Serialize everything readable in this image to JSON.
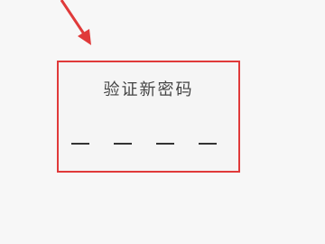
{
  "dialog": {
    "title": "验证新密码",
    "slots": [
      "",
      "",
      "",
      ""
    ]
  },
  "colors": {
    "highlight_border": "#e03a3a",
    "arrow": "#e03a3a",
    "title_text": "#444444",
    "slot_line": "#333333",
    "background": "#f7f7f7"
  },
  "icons": {
    "pointer_arrow": "arrow-down-right-icon"
  }
}
